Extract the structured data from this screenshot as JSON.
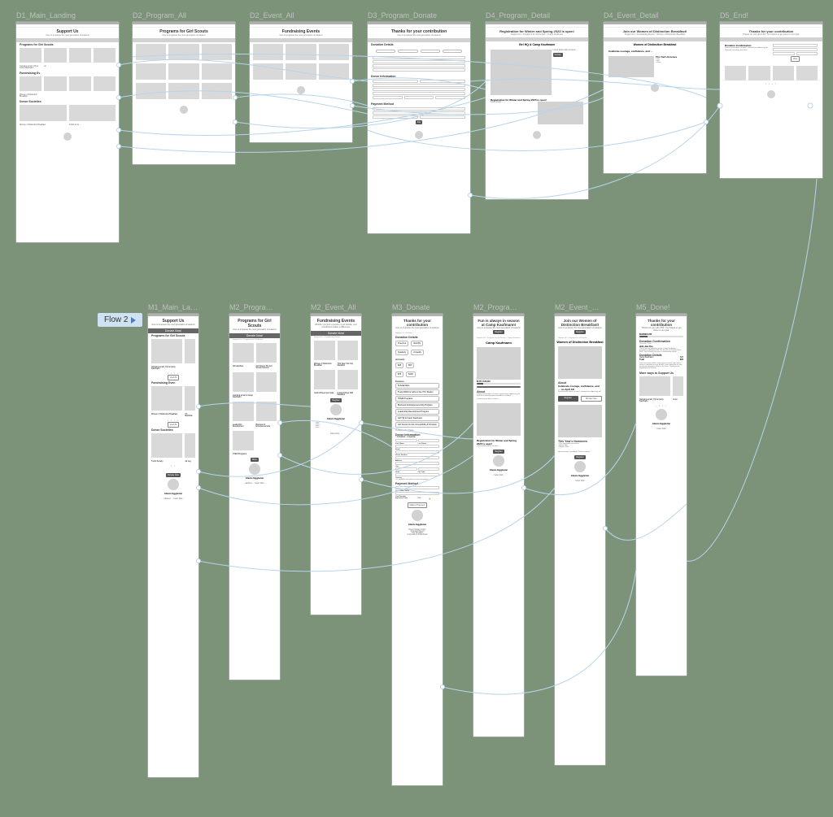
{
  "flow2_label": "Flow 2",
  "desktop": {
    "d1": {
      "label": "D1_Main_Landing",
      "title": "Support Us",
      "sub": "Give to empower the next generation of leaders!",
      "s1": "Programs for Girl Scouts",
      "c1": "Camping at Girl_HQ & Camp Kaufmann",
      "c2": "Ac",
      "s2": "Fundraising Ev",
      "c3": "Women of Distinction Breakfast",
      "s3": "Donor Societies",
      "c4": "Women of Distinction Breakfast",
      "c5": "T-Shirt & Co."
    },
    "d2p": {
      "label": "D2_Program_All",
      "title": "Programs for Girl Scouts",
      "sub": "Give to empower the next generation of leaders!"
    },
    "d2e": {
      "label": "D2_Event_All",
      "title": "Fundraising Events",
      "sub": "Give to empower the next generation of leaders!"
    },
    "d3": {
      "label": "D3_Program_Donate",
      "title": "Thanks for your contribution",
      "sub": "Give to empower the next generation of leaders!",
      "s1": "Donation Details",
      "s2": "Donor Information",
      "s3": "Payment Method"
    },
    "d4p": {
      "label": "D4_Program_Detail",
      "title": "Registration for Winter and Spring 2023 is open!",
      "sub": "Support Us > Programs for Girl Scouts > Camp Kaufmann",
      "h2": "Girl HQ & Camp Kaufmann",
      "cta": "Donate",
      "note": "Registration for Winter and Spring 2023 is open!"
    },
    "d4e": {
      "label": "D4_Event_Detail",
      "title": "Join our Women of Distinction Breakfast!",
      "sub": "Support Us > Fundraising Events > Women of Distinction Breakfast",
      "h2": "Women of Distinction Breakfast",
      "quote": "Celebrate courage, confidence, and …",
      "s1": "This Year's Honorees"
    },
    "d5": {
      "label": "D5_End!",
      "title": "Thanks for your contribution",
      "sub": "Thanks for your gift of $X. You helped us get closer to our goal.",
      "s1": "Donation Confirmation"
    }
  },
  "mobile": {
    "m1": {
      "label": "M1_Main_La…",
      "title": "Support Us",
      "sub": "Give to empower the next generation of leaders!",
      "cta": "Donate Now!",
      "s1": "Programs for Girl Scouts",
      "c1": "Camping at Girl_HQ & Camp Kaufmann",
      "s2": "Fundraising Even",
      "c2": "Women of Distinction Breakfast",
      "c3": "YC Marathon",
      "view": "View All",
      "s3": "Donor Societies",
      "c4": "Trefoil Society",
      "c5": "Jul Leg",
      "donate": "Donate Now",
      "name": "Alexis Eggleton"
    },
    "m2p": {
      "label": "M2_Progra…",
      "title": "Programs for Girl Scouts",
      "sub": "Give to empower the next generation of leaders!",
      "cta": "Donate Now!",
      "bc": "Support Us > Programs for Girl Scouts",
      "t1": "Scholarships",
      "t2": "Girl Scouts The Girl Scouts  Summer",
      "t3": "Camping at Girl & Camp Kaufmann",
      "t4": "Leadership Development",
      "t5": "Business & Entrepreneurship",
      "t6": "STEM Programs",
      "more": "More",
      "name": "Alexis Eggleton"
    },
    "m2e": {
      "label": "M2_Event_All",
      "title": "Fundraising Events",
      "sub": "Whether you join in person or just donate, your contribution makes a difference.",
      "cta": "Donate Now!",
      "bc": "Support Us > Fundraising Events",
      "t1": "Women of Distinction Breakfast",
      "t2": "TCS New York City Marathon",
      "t3": "Gold Achievement Gala",
      "t4": "United Airlines Half Marathon",
      "reg": "Register",
      "name": "Alexis Eggleton"
    },
    "m3": {
      "label": "M3_Donate",
      "title": "Thanks for your contribution",
      "sub": "Give to empower the next generation of leaders!",
      "bc": "Support Us > Donate",
      "s1": "Donation Details",
      "p1": "One-time",
      "p2": "Monthly",
      "p3": "Quarterly",
      "p4": "Annually",
      "amt": "Amount",
      "a1": "$25",
      "a2": "$50",
      "a3": "$75",
      "a4": "$100",
      "causes": "Causes",
      "o1": "Scholarships",
      "o2": "Troop 6000 for Girls in the NYC Shelter",
      "o3": "STEM Programs",
      "o4": "Business & Entrepreneurship Program",
      "o5": "Leadership Development Program",
      "o6": "Girl HQ & Camp Kaufmann",
      "o7": "Girl Scouts for ALL Accessibility & Inclusion",
      "chk": "Add Another Cause",
      "s2": "Donor Information",
      "r1": "Individual",
      "r2": "Corporate",
      "f1": "First Name",
      "f2": "Last Name",
      "f3": "Email",
      "f4": "Phone Number",
      "f5": "Address",
      "f6": "City",
      "f7": "State",
      "f8": "Zip Code",
      "f9": "Country",
      "gift": "I would like this gift to remain anonymous",
      "s3": "Payment Method",
      "c1": "Cardholder Name",
      "c2": "Card Number",
      "c3": "Expiration Date",
      "c4": "CVV",
      "pay": "Make a Payment",
      "name": "Alexis Eggleton",
      "ft1": "Donor Privacy Policy",
      "ft2": "Financial Report",
      "ft3": "Your Donation",
      "ft4": "Corporate & Institutional"
    },
    "m2pd": {
      "label": "M2_Progra…",
      "title": "Fun is always in season at Camp Kaufmann!",
      "sub": "Give to empower the next generation of leaders!",
      "cta": "Register",
      "bc": "Support Us > Programs for Girl Scouts > Camp Kaufmann",
      "h2": "Camp Kaufmann",
      "raised": "$1473 / $10,000",
      "about": "About",
      "note": "Registration for Winter and Spring 2023 is open!",
      "reg": "Register",
      "name": "Alexis Eggleton"
    },
    "m2ed": {
      "label": "M2_Event_…",
      "title": "Join our Women of Distinction Breakfast!",
      "sub": "Give to empower the next generation of leaders!",
      "cta": "Register",
      "bc": "Support Us > Programs for Girl Scouts",
      "h2": "Women of Distinction Breakfast",
      "about": "About",
      "quote": "Celebrate courage, confidence, and … on April 19!",
      "nom": "This Year's Nominees",
      "reg": "Register",
      "don": "Donate Now",
      "spons": "Sponsorship is available! Please contact …",
      "cta2": "Register",
      "name": "Alexis Eggleton"
    },
    "m5": {
      "label": "M5_Done!",
      "title": "Thanks for your contribution",
      "sub": "Thanks for your gift of $X. You helped us get closer to our goal.",
      "prog": "$1903/$10,000",
      "s1": "Donation Confirmation",
      "code": "Donation Code #",
      "hello": "Hello Jane Doe,",
      "body": "Thank you for donating to the Camp Kaufmann program in affiliation with Girl Scouts of Greater New York. You'll shortly receive a confirmation email.",
      "s2": "Donation Details",
      "d1": "Camp Kaufmann",
      "d2": "$25",
      "tot": "Total",
      "totv": "$25",
      "note": "Your tax receipt will be sent to you via email. No further action is required on your behalf. If you would like to view or edit your donation, please click here. Thank you for supporting Girl Scouts.",
      "s3": "More ways to Support Us",
      "c1": "Camping at Girl_HQ & Camp Kaufmann",
      "c2": "Gi Ac",
      "name": "Alexis Eggleton"
    }
  }
}
